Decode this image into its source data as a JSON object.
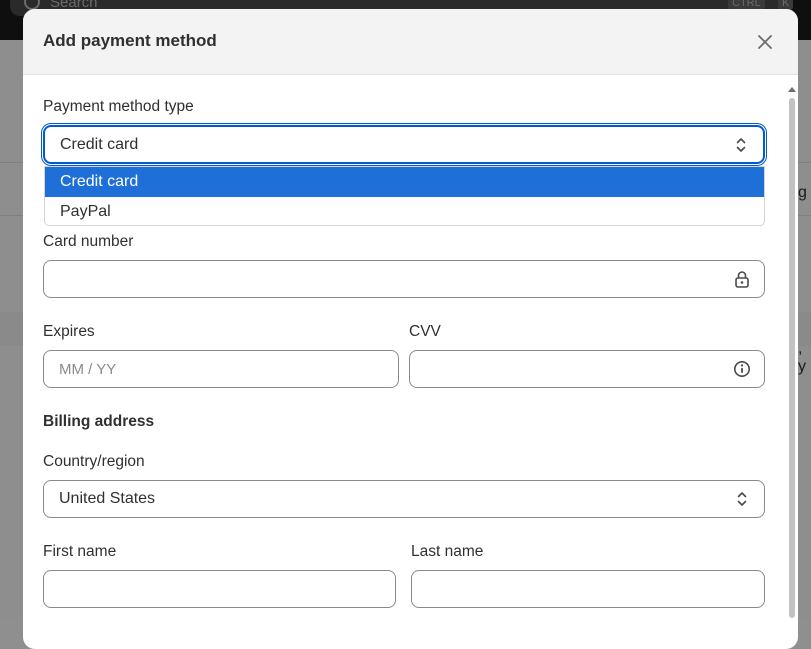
{
  "background": {
    "search_placeholder": "Search",
    "shortcut_keys": [
      "CTRL",
      "K"
    ],
    "right_edge_fragments": [
      "g",
      ", y"
    ]
  },
  "modal": {
    "title": "Add payment method",
    "close_icon": "close-icon"
  },
  "form": {
    "payment_method_type": {
      "label": "Payment method type",
      "value": "Credit card",
      "options": [
        {
          "label": "Credit card",
          "selected": true
        },
        {
          "label": "PayPal",
          "selected": false
        }
      ]
    },
    "card_number": {
      "label": "Card number",
      "value": "",
      "icon": "lock-icon"
    },
    "expires": {
      "label": "Expires",
      "placeholder": "MM / YY",
      "value": ""
    },
    "cvv": {
      "label": "CVV",
      "value": "",
      "icon": "info-icon"
    },
    "billing_section_title": "Billing address",
    "country": {
      "label": "Country/region",
      "value": "United States"
    },
    "first_name": {
      "label": "First name",
      "value": ""
    },
    "last_name": {
      "label": "Last name",
      "value": ""
    }
  },
  "colors": {
    "focus_ring": "#005bd3",
    "selected_option": "#1e6fd8",
    "overlay": "#8e8e8e"
  }
}
